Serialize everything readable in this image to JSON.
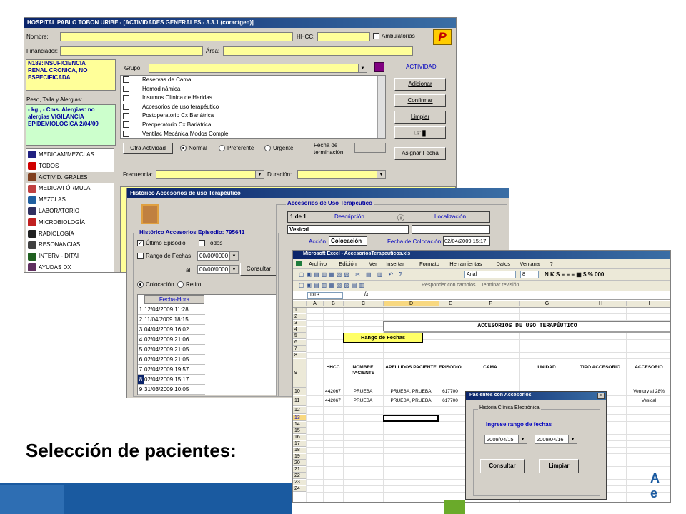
{
  "main": {
    "title": "HOSPITAL PABLO TOBON URIBE - [ACTIVIDADES GENERALES - 3.3.1 (coractgen)]",
    "nombre_label": "Nombre:",
    "hhcc_label": "HHCC:",
    "ambulatorias_label": "Ambulatorias",
    "financiador_label": "Financiador:",
    "area_label": "Área:",
    "diagnostico": "N189:INSUFICIENCIA RENAL CRONICA, NO ESPECIFICADA",
    "peso_label": "Peso, Talla y Alergias:",
    "peso_text": " - kg., - Cms. Alergias: no alergias VIGILANCIA EPIDEMIOLOGICA 2/04/09",
    "grupo_label": "Grupo:",
    "actividad_label": "ACTIVIDAD",
    "actividades": [
      "Reservas de Cama",
      "Hemodinámica",
      "Insumos Clínica de Heridas",
      "Accesorios de uso terapéutico",
      "Postoperatorio Cx Bariátrica",
      "Preoperatorio Cx Bariátrica",
      "Ventilac Mecánica Modos Comple"
    ],
    "menu": [
      {
        "label": "MEDICAM/MEZCLAS",
        "icon": "pills-icon"
      },
      {
        "label": "TODOS",
        "icon": "heart-icon"
      },
      {
        "label": "ACTIVID. GRALES",
        "icon": "person-icon"
      },
      {
        "label": "MEDICA/FÓRMULA",
        "icon": "prescription-icon"
      },
      {
        "label": "MEZCLAS",
        "icon": "mixture-icon"
      },
      {
        "label": "LABORATORIO",
        "icon": "flask-icon"
      },
      {
        "label": "MICROBIOLOGÍA",
        "icon": "microscope-icon"
      },
      {
        "label": "RADIOLOGÍA",
        "icon": "radiation-icon"
      },
      {
        "label": "RESONANCIAS",
        "icon": "warning-icon"
      },
      {
        "label": "INTERV - DITAI",
        "icon": "intervention-icon"
      },
      {
        "label": "AYUDAS DX",
        "icon": "help-icon"
      }
    ],
    "buttons": {
      "adicionar": "Adicionar",
      "confirmar": "Confirmar",
      "limpiar": "Limpiar",
      "asignar": "Asignar Fecha",
      "otra": "Otra Actividad"
    },
    "prioridad": [
      "Normal",
      "Preferente",
      "Urgente"
    ],
    "fecha_term_label": "Fecha de terminación:",
    "frecuencia_label": "Frecuencia:",
    "duracion_label": "Duración:"
  },
  "hist": {
    "title": "Histórico Accesorios de uso Terapéutico",
    "grp_label": "Histórico Accesorios   Episodio:  795641",
    "ultimo": "Último Episodio",
    "todos": "Todos",
    "rango": "Rango de Fechas",
    "date1": "00/00/0000",
    "al": "al",
    "date2": "00/00/0000",
    "consultar": "Consultar",
    "colocacion": "Colocación",
    "retiro": "Retiro",
    "col_header": "Fecha-Hora",
    "rows": [
      [
        "1",
        "12/04/2009 11:28"
      ],
      [
        "2",
        "11/04/2009 18:15"
      ],
      [
        "3",
        "04/04/2009 16:02"
      ],
      [
        "4",
        "02/04/2009 21:06"
      ],
      [
        "5",
        "02/04/2009 21:05"
      ],
      [
        "6",
        "02/04/2009 21:05"
      ],
      [
        "7",
        "02/04/2009 19:57"
      ],
      [
        "8",
        "02/04/2009 15:17"
      ],
      [
        "9",
        "31/03/2009 10:05"
      ]
    ],
    "acc_title": "Accesorios de Uso Terapéutico",
    "pager": "1 de 1",
    "desc_label": "Descripción",
    "loc_label": "Localización",
    "desc_value": "Vesical",
    "accion_label": "Acción",
    "accion_value": "Colocación",
    "fecha_col_label": "Fecha de Colocación:",
    "fecha_col_value": "02/04/2009 15:17"
  },
  "excel": {
    "title": "Microsoft Excel - AccesoriosTerapeuticos.xls",
    "menus": [
      "Archivo",
      "Edición",
      "Ver",
      "Insertar",
      "Formato",
      "Herramientas",
      "Datos",
      "Ventana",
      "?"
    ],
    "font": "Arial",
    "size": "8",
    "reply": "Responder con cambios...   Terminar revisión...",
    "cellref": "D13",
    "fx": "fx",
    "cols": [
      "A",
      "B",
      "C",
      "D",
      "E",
      "F",
      "G",
      "H",
      "I"
    ],
    "banner": "ACCESORIOS DE USO TERAPÉUTICO",
    "rango_btn": "Rango de Fechas",
    "headers": [
      "HHCC",
      "NOMBRE PACIENTE",
      "APELLIDOS PACIENTE",
      "EPISODIO",
      "CAMA",
      "UNIDAD",
      "TIPO ACCESORIO",
      "ACCESORIO"
    ],
    "data": [
      [
        "442067",
        "PRUEBA",
        "PRUEBA, PRUEBA",
        "617700",
        "Ventury al 28%"
      ],
      [
        "442067",
        "PRUEBA",
        "PRUEBA, PRUEBA",
        "617700",
        "Vesical"
      ]
    ],
    "rownums": [
      "1",
      "2",
      "3",
      "4",
      "5",
      "6",
      "7",
      "8",
      "9",
      "10",
      "11",
      "12",
      "13",
      "14",
      "15",
      "16",
      "17",
      "18",
      "19",
      "20",
      "21",
      "22",
      "23",
      "24"
    ]
  },
  "dialog": {
    "title": "Pacientes con Accesorios",
    "group": "Historia Clínica Electrónica",
    "prompt": "Ingrese rango de fechas",
    "from": "2009/04/15",
    "to": "2009/04/16",
    "consultar": "Consultar",
    "limpiar": "Limpiar"
  },
  "caption": "Selección de pacientes:"
}
